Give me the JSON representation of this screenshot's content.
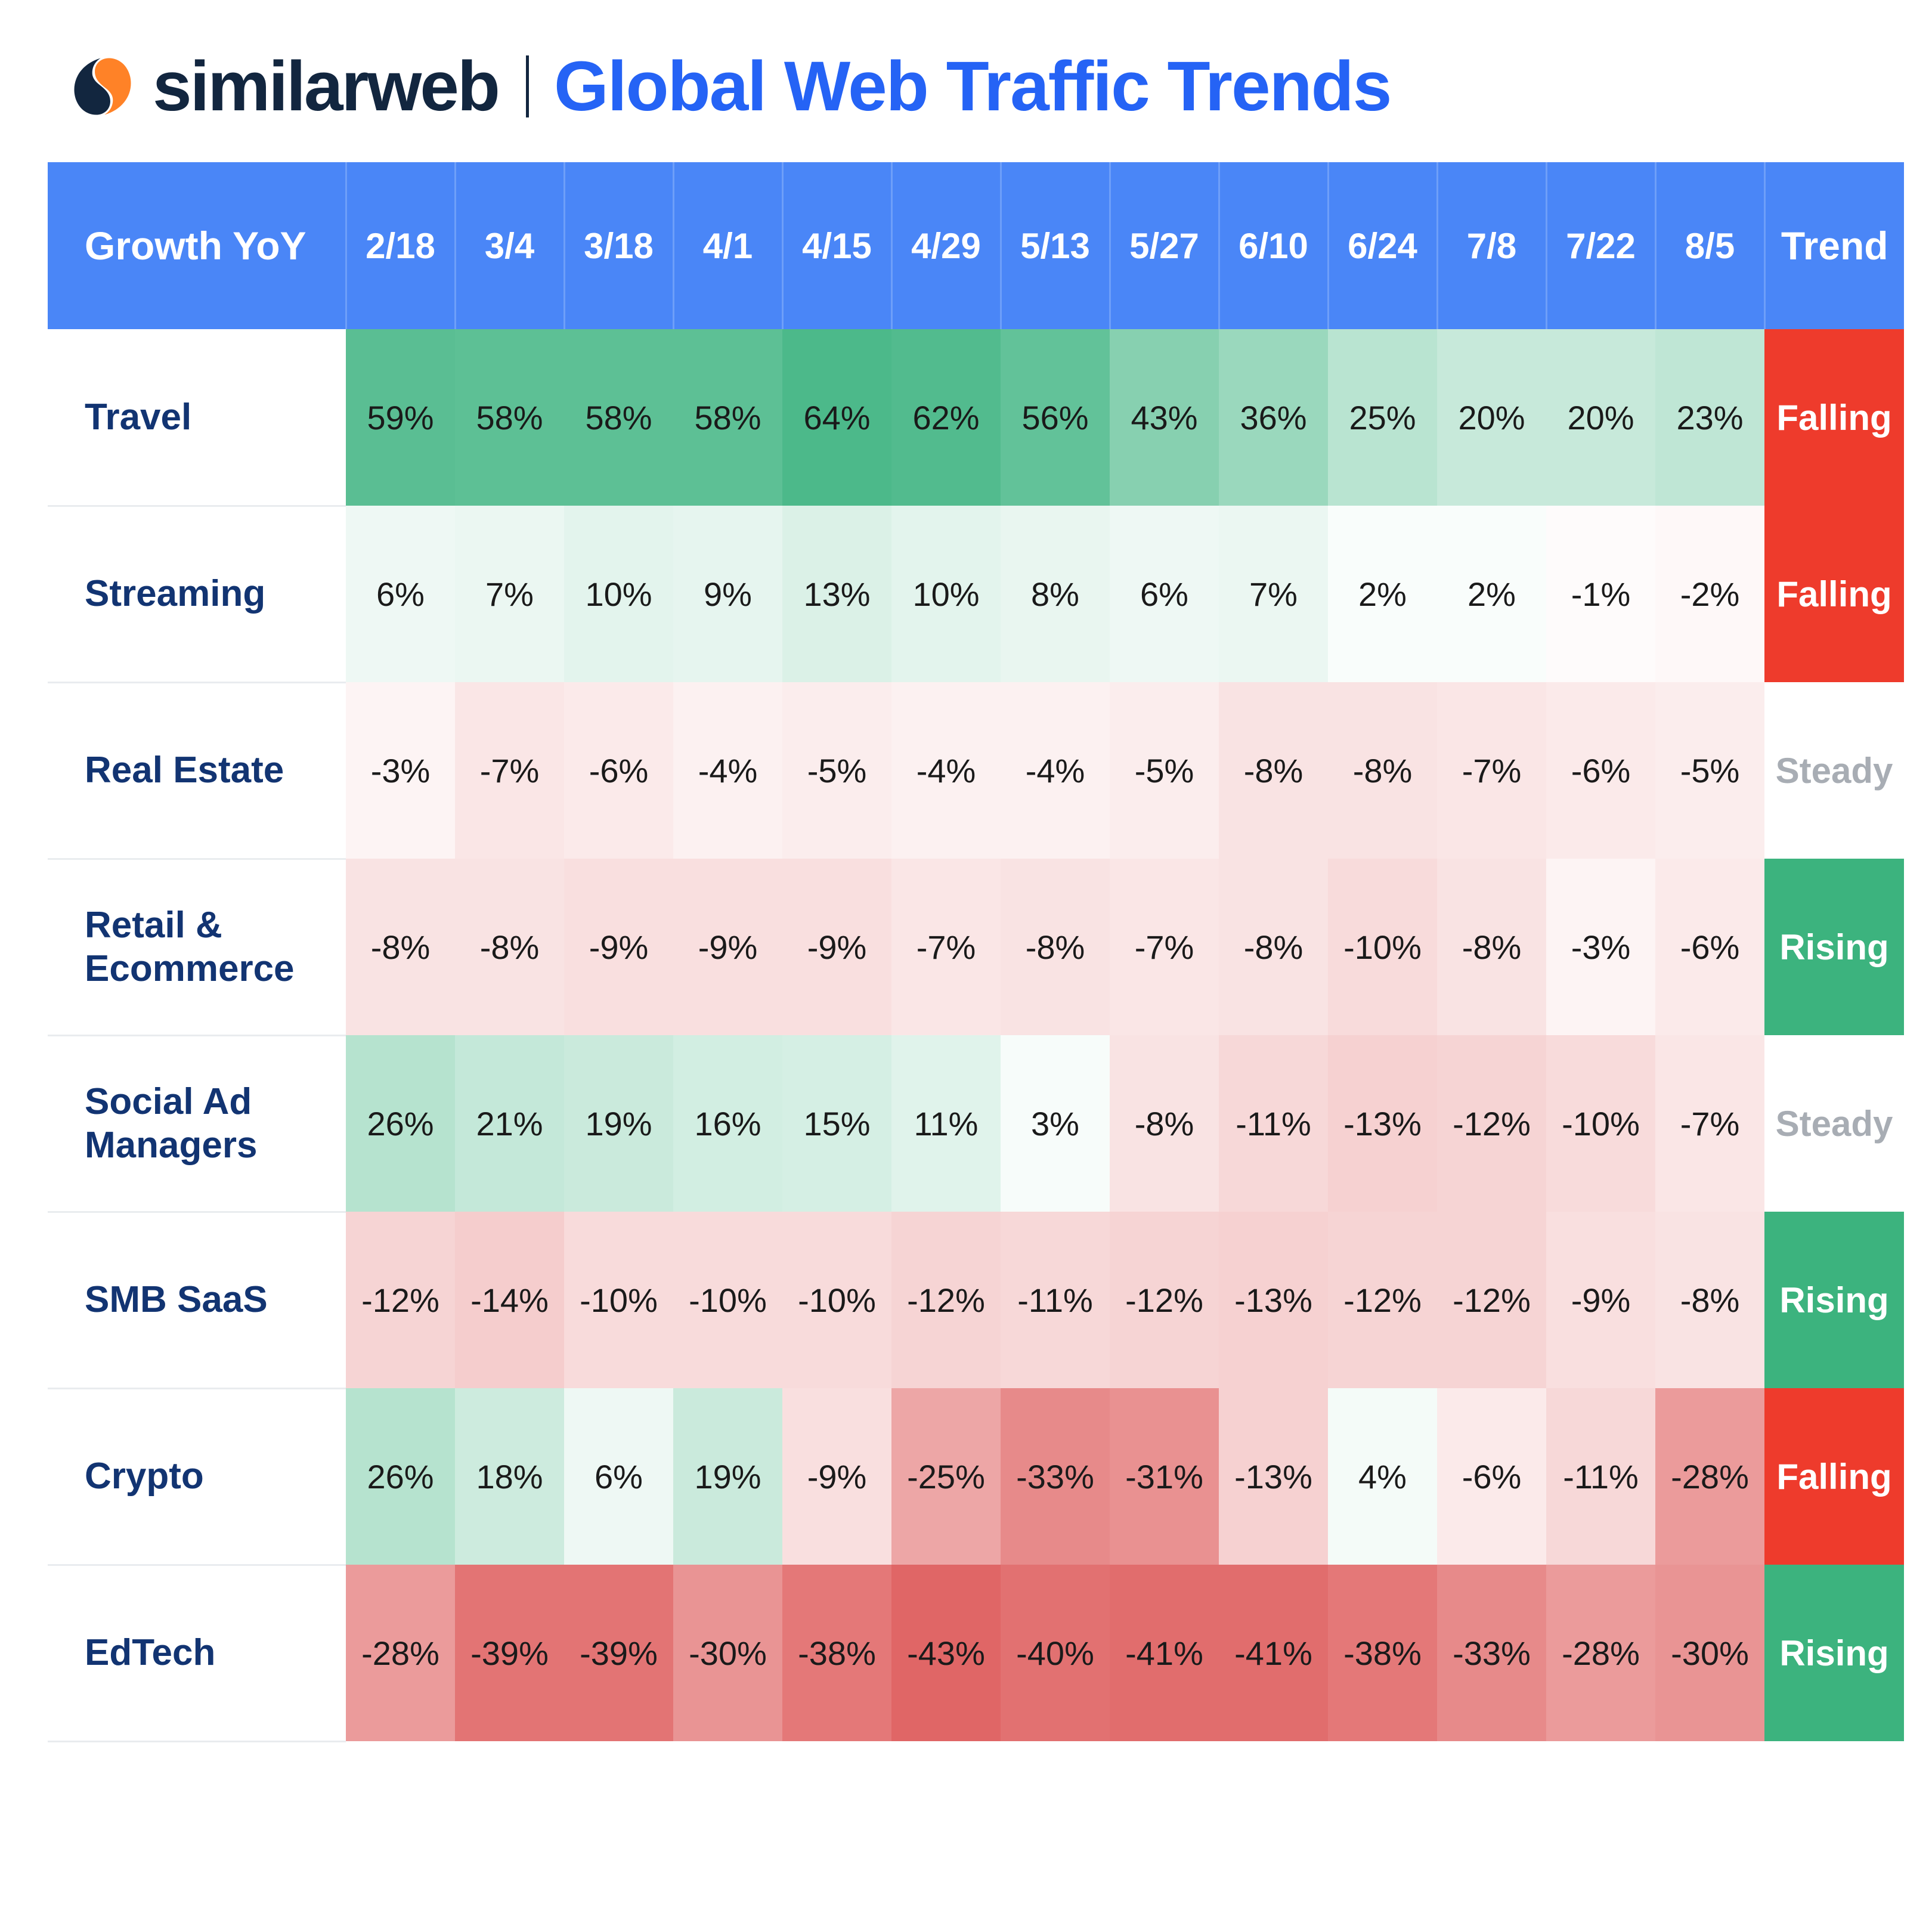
{
  "header": {
    "brand": "similarweb",
    "title": "Global Web Traffic Trends",
    "logo_icon": "similarweb-logo-icon",
    "divider_icon": "vertical-divider-icon",
    "brand_color": "#12263f",
    "accent_color": "#ff8227",
    "title_color": "#2563f5"
  },
  "chart_data": {
    "type": "heatmap",
    "title": "Global Web Traffic Trends",
    "xlabel": "",
    "ylabel": "",
    "row_header_label": "Growth YoY",
    "trend_header_label": "Trend",
    "categories": [
      "2/18",
      "3/4",
      "3/18",
      "4/1",
      "4/15",
      "4/29",
      "5/13",
      "5/27",
      "6/10",
      "6/24",
      "7/8",
      "7/22",
      "8/5"
    ],
    "legend": [],
    "grid": false,
    "colors": {
      "header_blue": "#4a86f7",
      "positive_max": "#4cb98a",
      "negative_max": "#e06666",
      "falling": "#ee3b2c",
      "rising": "#3cb37e",
      "steady_text": "#a8adb4"
    },
    "series": [
      {
        "name": "Travel",
        "values": [
          59,
          58,
          58,
          58,
          64,
          62,
          56,
          43,
          36,
          25,
          20,
          20,
          23
        ],
        "display": [
          "59%",
          "58%",
          "58%",
          "58%",
          "64%",
          "62%",
          "56%",
          "43%",
          "36%",
          "25%",
          "20%",
          "20%",
          "23%"
        ],
        "trend": "Falling"
      },
      {
        "name": "Streaming",
        "values": [
          6,
          7,
          10,
          9,
          13,
          10,
          8,
          6,
          7,
          2,
          2,
          -1,
          -2
        ],
        "display": [
          "6%",
          "7%",
          "10%",
          "9%",
          "13%",
          "10%",
          "8%",
          "6%",
          "7%",
          "2%",
          "2%",
          "-1%",
          "-2%"
        ],
        "trend": "Falling"
      },
      {
        "name": "Real Estate",
        "values": [
          -3,
          -7,
          -6,
          -4,
          -5,
          -4,
          -4,
          -5,
          -8,
          -8,
          -7,
          -6,
          -5
        ],
        "display": [
          "-3%",
          "-7%",
          "-6%",
          "-4%",
          "-5%",
          "-4%",
          "-4%",
          "-5%",
          "-8%",
          "-8%",
          "-7%",
          "-6%",
          "-5%"
        ],
        "trend": "Steady"
      },
      {
        "name": "Retail & Ecommerce",
        "values": [
          -8,
          -8,
          -9,
          -9,
          -9,
          -7,
          -8,
          -7,
          -8,
          -10,
          -8,
          -3,
          -6
        ],
        "display": [
          "-8%",
          "-8%",
          "-9%",
          "-9%",
          "-9%",
          "-7%",
          "-8%",
          "-7%",
          "-8%",
          "-10%",
          "-8%",
          "-3%",
          "-6%"
        ],
        "trend": "Rising"
      },
      {
        "name": "Social Ad Managers",
        "values": [
          26,
          21,
          19,
          16,
          15,
          11,
          3,
          -8,
          -11,
          -13,
          -12,
          -10,
          -7
        ],
        "display": [
          "26%",
          "21%",
          "19%",
          "16%",
          "15%",
          "11%",
          "3%",
          "-8%",
          "-11%",
          "-13%",
          "-12%",
          "-10%",
          "-7%"
        ],
        "trend": "Steady"
      },
      {
        "name": "SMB SaaS",
        "values": [
          -12,
          -14,
          -10,
          -10,
          -10,
          -12,
          -11,
          -12,
          -13,
          -12,
          -12,
          -9,
          -8
        ],
        "display": [
          "-12%",
          "-14%",
          "-10%",
          "-10%",
          "-10%",
          "-12%",
          "-11%",
          "-12%",
          "-13%",
          "-12%",
          "-12%",
          "-9%",
          "-8%"
        ],
        "trend": "Rising"
      },
      {
        "name": "Crypto",
        "values": [
          26,
          18,
          6,
          19,
          -9,
          -25,
          -33,
          -31,
          -13,
          4,
          -6,
          -11,
          -28
        ],
        "display": [
          "26%",
          "18%",
          "6%",
          "19%",
          "-9%",
          "-25%",
          "-33%",
          "-31%",
          "-13%",
          "4%",
          "-6%",
          "-11%",
          "-28%"
        ],
        "trend": "Falling"
      },
      {
        "name": "EdTech",
        "values": [
          -28,
          -39,
          -39,
          -30,
          -38,
          -43,
          -40,
          -41,
          -41,
          -38,
          -33,
          -28,
          -30
        ],
        "display": [
          "-28%",
          "-39%",
          "-39%",
          "-30%",
          "-38%",
          "-43%",
          "-40%",
          "-41%",
          "-41%",
          "-38%",
          "-33%",
          "-28%",
          "-30%"
        ],
        "trend": "Rising"
      }
    ]
  }
}
